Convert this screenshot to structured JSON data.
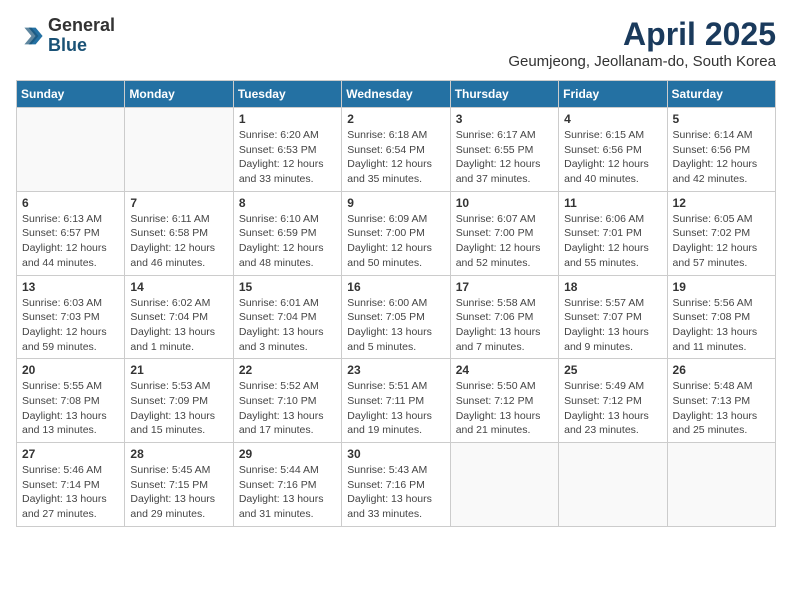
{
  "logo": {
    "general": "General",
    "blue": "Blue"
  },
  "title": "April 2025",
  "location": "Geumjeong, Jeollanam-do, South Korea",
  "days_of_week": [
    "Sunday",
    "Monday",
    "Tuesday",
    "Wednesday",
    "Thursday",
    "Friday",
    "Saturday"
  ],
  "weeks": [
    [
      {
        "day": "",
        "info": ""
      },
      {
        "day": "",
        "info": ""
      },
      {
        "day": "1",
        "info": "Sunrise: 6:20 AM\nSunset: 6:53 PM\nDaylight: 12 hours and 33 minutes."
      },
      {
        "day": "2",
        "info": "Sunrise: 6:18 AM\nSunset: 6:54 PM\nDaylight: 12 hours and 35 minutes."
      },
      {
        "day": "3",
        "info": "Sunrise: 6:17 AM\nSunset: 6:55 PM\nDaylight: 12 hours and 37 minutes."
      },
      {
        "day": "4",
        "info": "Sunrise: 6:15 AM\nSunset: 6:56 PM\nDaylight: 12 hours and 40 minutes."
      },
      {
        "day": "5",
        "info": "Sunrise: 6:14 AM\nSunset: 6:56 PM\nDaylight: 12 hours and 42 minutes."
      }
    ],
    [
      {
        "day": "6",
        "info": "Sunrise: 6:13 AM\nSunset: 6:57 PM\nDaylight: 12 hours and 44 minutes."
      },
      {
        "day": "7",
        "info": "Sunrise: 6:11 AM\nSunset: 6:58 PM\nDaylight: 12 hours and 46 minutes."
      },
      {
        "day": "8",
        "info": "Sunrise: 6:10 AM\nSunset: 6:59 PM\nDaylight: 12 hours and 48 minutes."
      },
      {
        "day": "9",
        "info": "Sunrise: 6:09 AM\nSunset: 7:00 PM\nDaylight: 12 hours and 50 minutes."
      },
      {
        "day": "10",
        "info": "Sunrise: 6:07 AM\nSunset: 7:00 PM\nDaylight: 12 hours and 52 minutes."
      },
      {
        "day": "11",
        "info": "Sunrise: 6:06 AM\nSunset: 7:01 PM\nDaylight: 12 hours and 55 minutes."
      },
      {
        "day": "12",
        "info": "Sunrise: 6:05 AM\nSunset: 7:02 PM\nDaylight: 12 hours and 57 minutes."
      }
    ],
    [
      {
        "day": "13",
        "info": "Sunrise: 6:03 AM\nSunset: 7:03 PM\nDaylight: 12 hours and 59 minutes."
      },
      {
        "day": "14",
        "info": "Sunrise: 6:02 AM\nSunset: 7:04 PM\nDaylight: 13 hours and 1 minute."
      },
      {
        "day": "15",
        "info": "Sunrise: 6:01 AM\nSunset: 7:04 PM\nDaylight: 13 hours and 3 minutes."
      },
      {
        "day": "16",
        "info": "Sunrise: 6:00 AM\nSunset: 7:05 PM\nDaylight: 13 hours and 5 minutes."
      },
      {
        "day": "17",
        "info": "Sunrise: 5:58 AM\nSunset: 7:06 PM\nDaylight: 13 hours and 7 minutes."
      },
      {
        "day": "18",
        "info": "Sunrise: 5:57 AM\nSunset: 7:07 PM\nDaylight: 13 hours and 9 minutes."
      },
      {
        "day": "19",
        "info": "Sunrise: 5:56 AM\nSunset: 7:08 PM\nDaylight: 13 hours and 11 minutes."
      }
    ],
    [
      {
        "day": "20",
        "info": "Sunrise: 5:55 AM\nSunset: 7:08 PM\nDaylight: 13 hours and 13 minutes."
      },
      {
        "day": "21",
        "info": "Sunrise: 5:53 AM\nSunset: 7:09 PM\nDaylight: 13 hours and 15 minutes."
      },
      {
        "day": "22",
        "info": "Sunrise: 5:52 AM\nSunset: 7:10 PM\nDaylight: 13 hours and 17 minutes."
      },
      {
        "day": "23",
        "info": "Sunrise: 5:51 AM\nSunset: 7:11 PM\nDaylight: 13 hours and 19 minutes."
      },
      {
        "day": "24",
        "info": "Sunrise: 5:50 AM\nSunset: 7:12 PM\nDaylight: 13 hours and 21 minutes."
      },
      {
        "day": "25",
        "info": "Sunrise: 5:49 AM\nSunset: 7:12 PM\nDaylight: 13 hours and 23 minutes."
      },
      {
        "day": "26",
        "info": "Sunrise: 5:48 AM\nSunset: 7:13 PM\nDaylight: 13 hours and 25 minutes."
      }
    ],
    [
      {
        "day": "27",
        "info": "Sunrise: 5:46 AM\nSunset: 7:14 PM\nDaylight: 13 hours and 27 minutes."
      },
      {
        "day": "28",
        "info": "Sunrise: 5:45 AM\nSunset: 7:15 PM\nDaylight: 13 hours and 29 minutes."
      },
      {
        "day": "29",
        "info": "Sunrise: 5:44 AM\nSunset: 7:16 PM\nDaylight: 13 hours and 31 minutes."
      },
      {
        "day": "30",
        "info": "Sunrise: 5:43 AM\nSunset: 7:16 PM\nDaylight: 13 hours and 33 minutes."
      },
      {
        "day": "",
        "info": ""
      },
      {
        "day": "",
        "info": ""
      },
      {
        "day": "",
        "info": ""
      }
    ]
  ]
}
